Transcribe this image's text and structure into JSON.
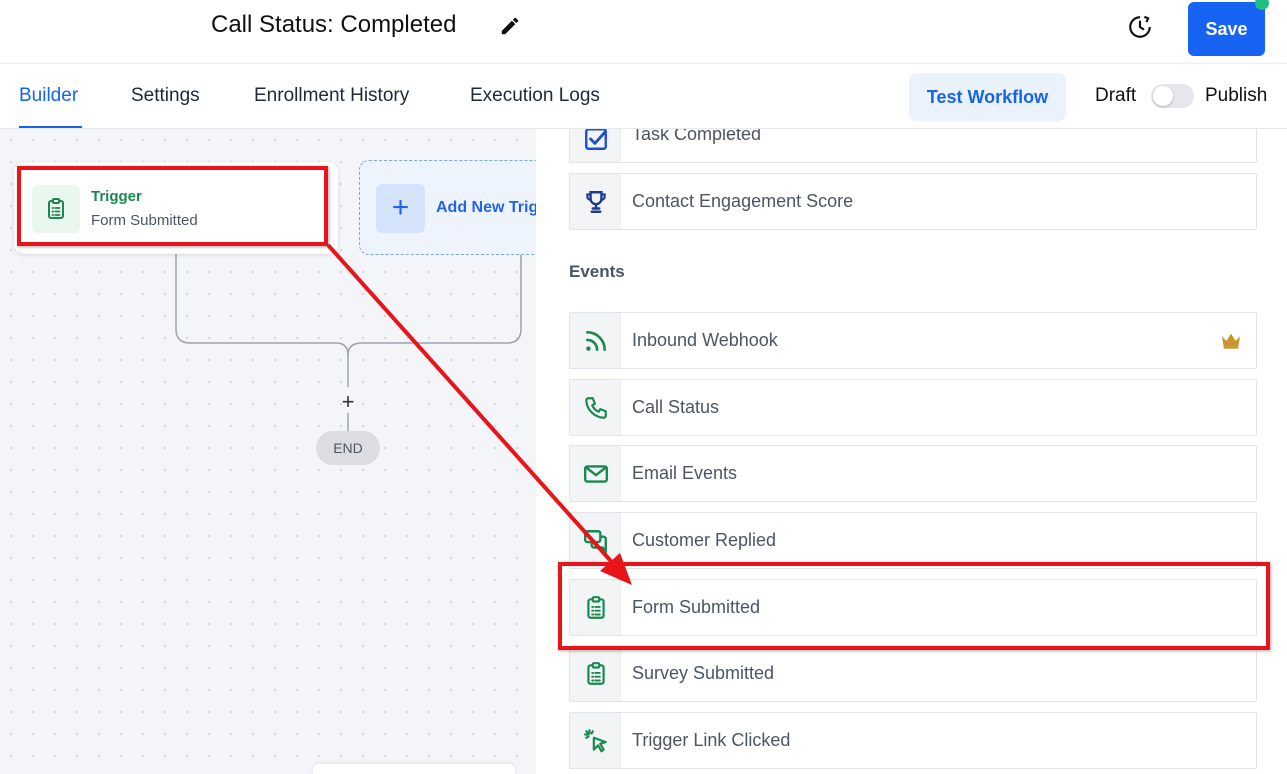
{
  "header": {
    "title": "Call Status: Completed",
    "save_label": "Save"
  },
  "tabs": [
    {
      "label": "Builder",
      "active": true
    },
    {
      "label": "Settings"
    },
    {
      "label": "Enrollment History"
    },
    {
      "label": "Execution Logs"
    }
  ],
  "actions": {
    "test_workflow": "Test Workflow",
    "draft": "Draft",
    "publish": "Publish",
    "published": false
  },
  "canvas": {
    "trigger_title": "Trigger",
    "trigger_subtitle": "Form Submitted",
    "add_trigger_label": "Add New Trigger",
    "end_label": "END"
  },
  "panel": {
    "items_top": [
      {
        "label": "Task Completed",
        "icon": "checkbox-icon"
      },
      {
        "label": "Contact Engagement Score",
        "icon": "trophy-icon"
      }
    ],
    "events_title": "Events",
    "events": [
      {
        "label": "Inbound Webhook",
        "icon": "webhook-icon",
        "premium": true
      },
      {
        "label": "Call Status",
        "icon": "phone-icon"
      },
      {
        "label": "Email Events",
        "icon": "envelope-icon"
      },
      {
        "label": "Customer Replied",
        "icon": "chat-icon"
      },
      {
        "label": "Form Submitted",
        "icon": "clipboard-icon",
        "highlighted": true
      },
      {
        "label": "Survey Submitted",
        "icon": "clipboard-icon"
      },
      {
        "label": "Trigger Link Clicked",
        "icon": "cursor-click-icon"
      }
    ]
  },
  "colors": {
    "primary": "#1764f4",
    "green": "#18894f",
    "annotation_red": "#e8141a"
  }
}
